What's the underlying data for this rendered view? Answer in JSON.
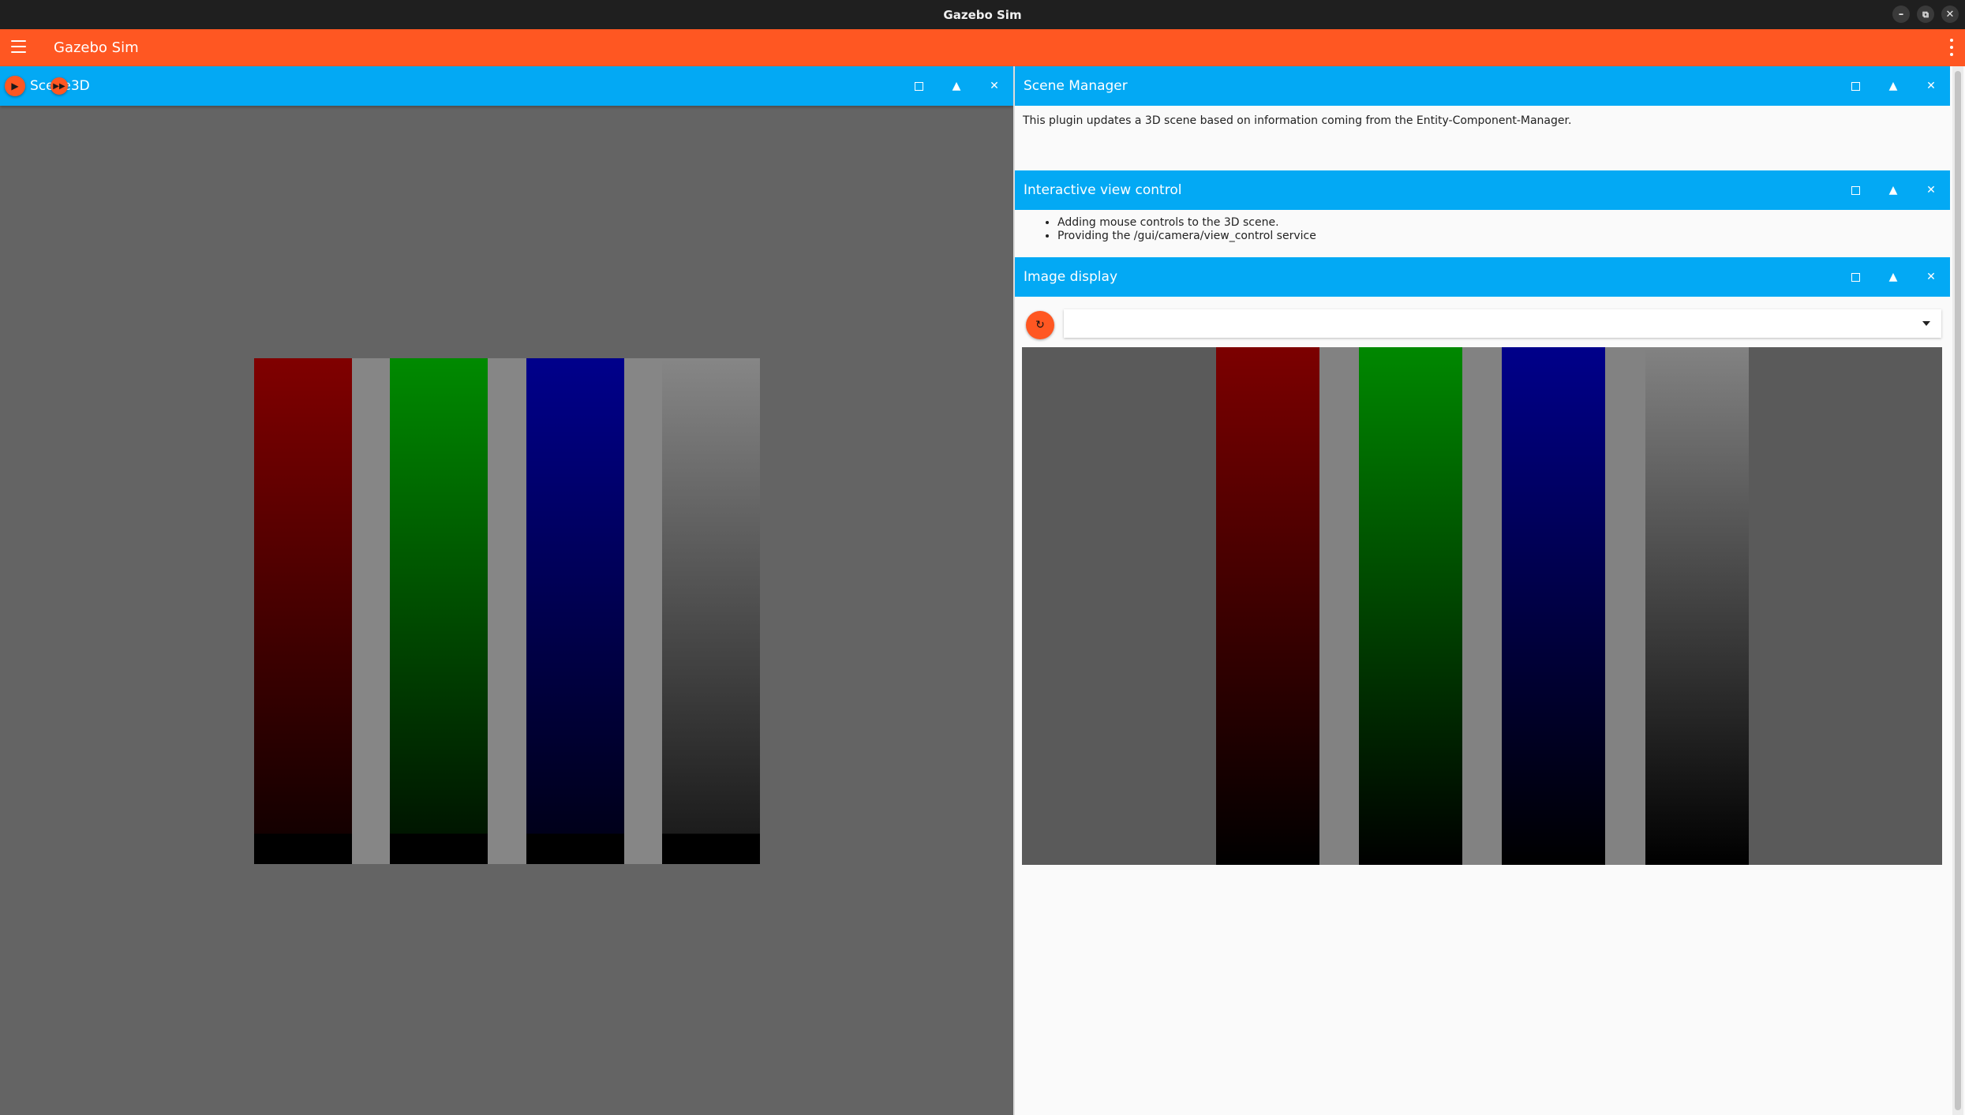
{
  "window": {
    "title": "Gazebo Sim",
    "controls": [
      "minimize-icon",
      "restore-icon",
      "close-icon"
    ]
  },
  "appbar": {
    "title": "Gazebo Sim",
    "menu_icon": "hamburger-icon",
    "overflow_icon": "more-vert-icon"
  },
  "scene": {
    "title": "Scene3D",
    "play_icon": "play-icon",
    "step_icon": "fast-forward-icon",
    "background_color": "#646464"
  },
  "panels": {
    "scene_manager": {
      "title": "Scene Manager",
      "description": "This plugin updates a 3D scene based on information coming from the Entity-Component-Manager."
    },
    "interactive_view": {
      "title": "Interactive view control",
      "bullets": [
        "Adding mouse controls to the 3D scene.",
        "Providing the /gui/camera/view_control service"
      ]
    },
    "image_display": {
      "title": "Image display",
      "refresh_icon": "refresh-icon",
      "topic_selected": ""
    }
  },
  "colors": {
    "accent": "#ff5722",
    "panel_header": "#03a9f4",
    "bar_red": "#800000",
    "bar_green": "#008a00",
    "bar_blue": "#00008b",
    "bar_gray": "#868686"
  }
}
